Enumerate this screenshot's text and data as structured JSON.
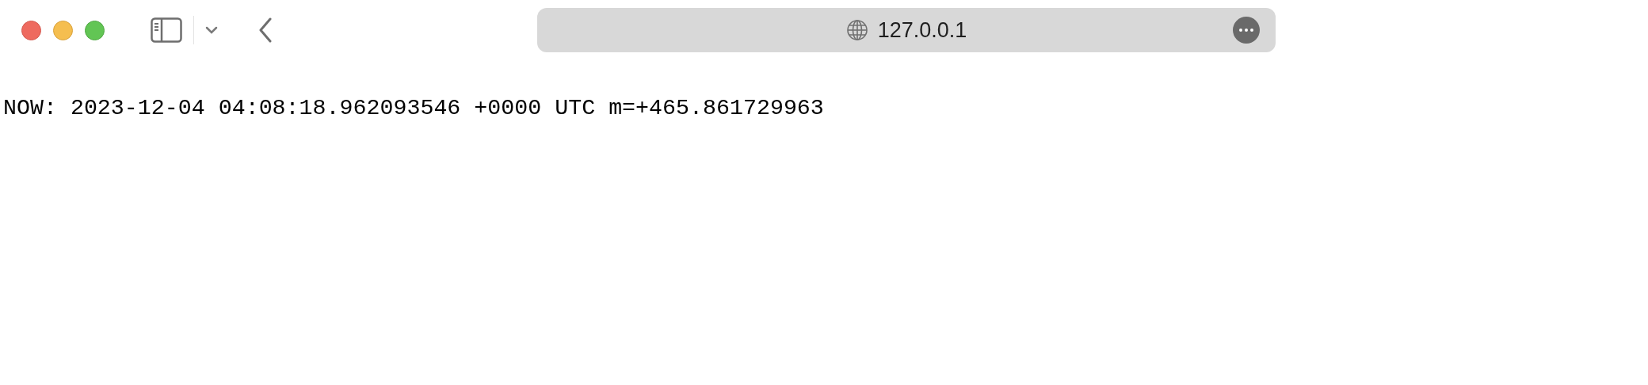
{
  "toolbar": {
    "address": "127.0.0.1"
  },
  "page": {
    "text": "NOW: 2023-12-04 04:08:18.962093546 +0000 UTC m=+465.861729963"
  }
}
